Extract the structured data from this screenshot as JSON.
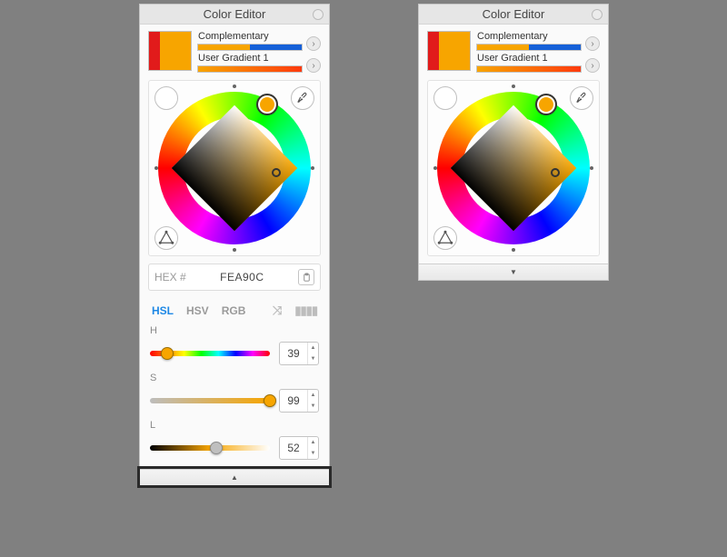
{
  "left": {
    "title": "Color Editor",
    "swatch": {
      "stripe": "#e11b1b",
      "fill": "#f7a500"
    },
    "presets": [
      {
        "label": "Complementary"
      },
      {
        "label": "User Gradient 1"
      }
    ],
    "hex": {
      "label": "HEX #",
      "value": "FEA90C"
    },
    "tabs": {
      "hsl": "HSL",
      "hsv": "HSV",
      "rgb": "RGB",
      "active": "HSL"
    },
    "sliders": {
      "h": {
        "label": "H",
        "value": 39,
        "max": 360
      },
      "s": {
        "label": "S",
        "value": 99,
        "max": 100
      },
      "l": {
        "label": "L",
        "value": 52,
        "max": 100
      }
    },
    "footer_glyph": "▲"
  },
  "right": {
    "title": "Color Editor",
    "swatch": {
      "stripe": "#e11b1b",
      "fill": "#f7a500"
    },
    "presets": [
      {
        "label": "Complementary"
      },
      {
        "label": "User Gradient 1"
      }
    ],
    "footer_glyph": "▼"
  }
}
